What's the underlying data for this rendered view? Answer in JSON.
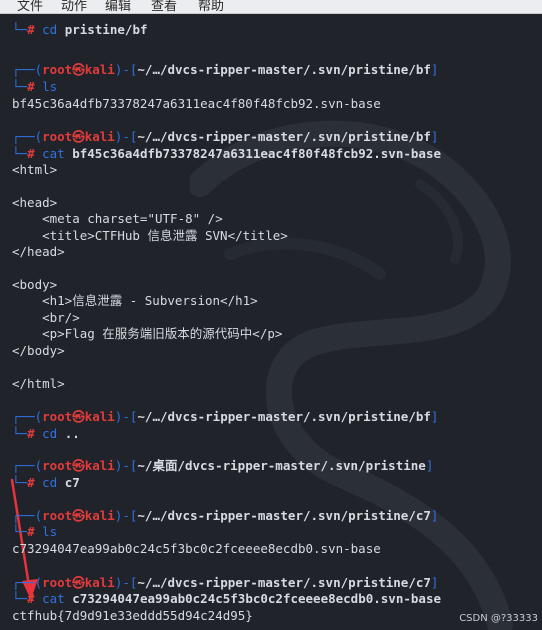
{
  "menu": [
    "文件",
    "动作",
    "编辑",
    "查看",
    "帮助"
  ],
  "prompt_user": "root",
  "prompt_at": "㉿",
  "prompt_host": "kali",
  "lines": [
    {
      "type": "promptend",
      "cmd": "cd",
      "arg": "pristine/bf"
    },
    {
      "type": "prompthead",
      "path": "~/…/dvcs-ripper-master/.svn/pristine/bf"
    },
    {
      "type": "promptend",
      "cmd": "ls",
      "arg": ""
    },
    {
      "type": "out",
      "text": "bf45c36a4dfb73378247a6311eac4f80f48fcb92.svn-base"
    },
    {
      "type": "prompthead",
      "path": "~/…/dvcs-ripper-master/.svn/pristine/bf"
    },
    {
      "type": "promptend",
      "cmd": "cat",
      "arg": "bf45c36a4dfb73378247a6311eac4f80f48fcb92.svn-base"
    },
    {
      "type": "out",
      "text": "<html>"
    },
    {
      "type": "out",
      "text": "<head>"
    },
    {
      "type": "out",
      "text": "    <meta charset=\"UTF-8\" />"
    },
    {
      "type": "out",
      "text": "    <title>CTFHub 信息泄露 SVN</title>"
    },
    {
      "type": "out",
      "text": "</head>"
    },
    {
      "type": "out",
      "text": "<body>"
    },
    {
      "type": "out",
      "text": "    <h1>信息泄露 - Subversion</h1>"
    },
    {
      "type": "out",
      "text": "    <br/>"
    },
    {
      "type": "out",
      "text": "    <p>Flag 在服务端旧版本的源代码中</p>"
    },
    {
      "type": "out",
      "text": "</body>"
    },
    {
      "type": "out",
      "text": "</html>"
    },
    {
      "type": "prompthead",
      "path": "~/…/dvcs-ripper-master/.svn/pristine/bf"
    },
    {
      "type": "promptend",
      "cmd": "cd",
      "arg": ".."
    },
    {
      "type": "prompthead",
      "path": "~/桌面/dvcs-ripper-master/.svn/pristine"
    },
    {
      "type": "promptend",
      "cmd": "cd",
      "arg": "c7"
    },
    {
      "type": "prompthead",
      "path": "~/…/dvcs-ripper-master/.svn/pristine/c7"
    },
    {
      "type": "promptend",
      "cmd": "ls",
      "arg": ""
    },
    {
      "type": "out",
      "text": "c73294047ea99ab0c24c5f3bc0c2fceeee8ecdb0.svn-base"
    },
    {
      "type": "prompthead",
      "path": "~/…/dvcs-ripper-master/.svn/pristine/c7"
    },
    {
      "type": "promptend",
      "cmd": "cat",
      "arg": "c73294047ea99ab0c24c5f3bc0c2fceeee8ecdb0.svn-base"
    },
    {
      "type": "out",
      "text": "ctfhub{7d9d91e33eddd55d94c24d95}"
    }
  ],
  "watermark": "CSDN @?33333",
  "colors": {
    "background": "#20232a",
    "prompt_frame": "#2f71e0",
    "prompt_user": "#e23b3b",
    "arrow": "#e8323c"
  }
}
